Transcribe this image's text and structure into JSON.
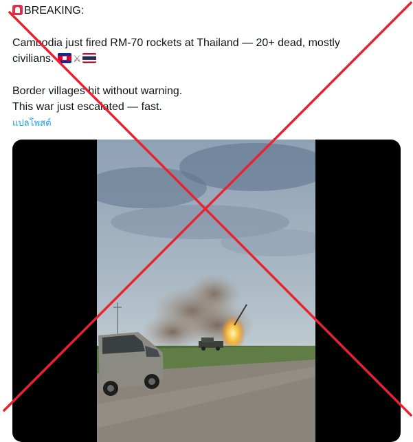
{
  "post": {
    "heading": "BREAKING:",
    "line1": "Cambodia just fired RM-70 rockets at Thailand — 20+ dead, mostly",
    "line2": "civilians.",
    "line3": "Border villages hit without warning.",
    "line4": "This war just escalated — fast.",
    "translate_link": "แปลโพสต์",
    "icons": [
      "siren-emoji",
      "cambodia-flag-emoji",
      "crossed-swords-emoji",
      "thailand-flag-emoji"
    ]
  },
  "media": {
    "type": "video-still",
    "scene": "rocket-launch-roadside-van"
  },
  "overlay": {
    "mark": "red-x",
    "color": "#e8232f"
  }
}
